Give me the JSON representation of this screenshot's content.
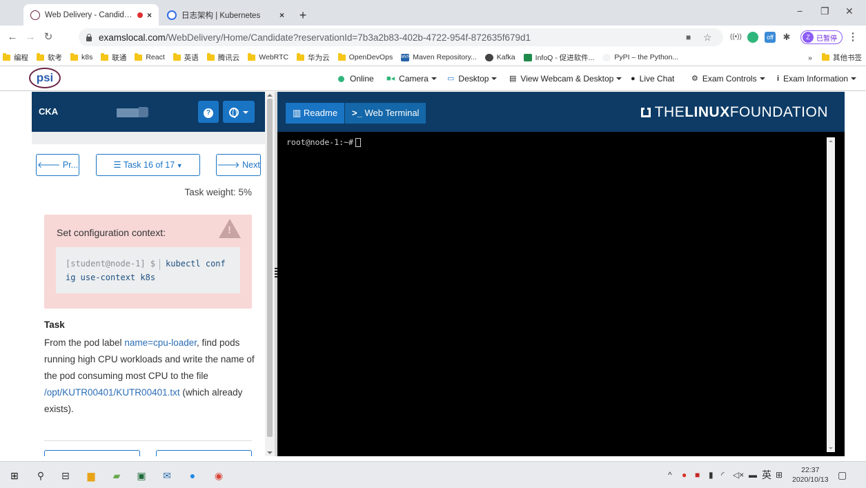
{
  "browser": {
    "tabs": [
      {
        "title": "Web Delivery - Candidate",
        "close": "×"
      },
      {
        "title": "日志架构 | Kubernetes",
        "close": "×"
      }
    ],
    "new_tab": "+",
    "window_controls": {
      "minimize": "−",
      "maximize": "❐",
      "close": "✕"
    },
    "url_host": "examslocal.com",
    "url_path": "/WebDelivery/Home/Candidate?reservationId=7b3a2b83-402b-4722-954f-872635f679d1",
    "profile_letter": "Z",
    "profile_status": "已暂停",
    "bookmarks": [
      "编程",
      "软考",
      "k8s",
      "联通",
      "React",
      "英语",
      "腾讯云",
      "WebRTC",
      "华为云",
      "OpenDevOps",
      "Maven Repository...",
      "Kafka",
      "InfoQ - 促进软件...",
      "PyPI – the Python..."
    ],
    "bookmarks_more": "»",
    "other_bookmarks": "其他书签"
  },
  "psi": {
    "logo": "psi",
    "toolbar": {
      "online": "Online",
      "camera": "Camera",
      "desktop": "Desktop",
      "view": "View Webcam & Desktop",
      "chat": "Live Chat",
      "controls": "Exam Controls",
      "info": "Exam Information"
    }
  },
  "task_panel": {
    "exam": "CKA",
    "prev": "Pr...",
    "task_selector": "Task 16 of 17",
    "next": "Next",
    "weight": "Task weight: 5%",
    "context_title": "Set configuration context:",
    "prompt": "[student@node-1] $",
    "cmd_line1": "kubectl conf",
    "cmd_line2": "ig use-context k8s",
    "task_heading": "Task",
    "task_text_1": "From the pod label",
    "task_label": "name=cpu-loader",
    "task_text_2": ", find pods running high CPU workloads and write the name of the pod consuming most CPU to the file",
    "task_file": "/opt/KUTR00401/KUTR00401.txt",
    "task_text_3": "(which already exists)."
  },
  "terminal_panel": {
    "readme": "Readme",
    "web_terminal": "Web Terminal",
    "lf_the": "THE",
    "lf_linux": "LINUX",
    "lf_foundation": "FOUNDATION",
    "prompt": "root@node-1:~#"
  },
  "taskbar": {
    "ime": "英",
    "time": "22:37",
    "date": "2020/10/13"
  },
  "colors": {
    "panel_header": "#0d3b66",
    "primary": "#1a74c4",
    "alert_bg": "#f8d7d7",
    "online": "#2fb67c"
  }
}
